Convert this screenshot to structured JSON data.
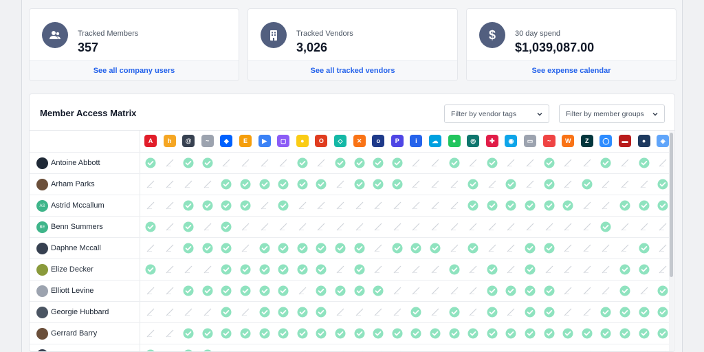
{
  "cards": [
    {
      "label": "Tracked Members",
      "value": "357",
      "link": "See all company users",
      "icon": "users-icon"
    },
    {
      "label": "Tracked Vendors",
      "value": "3,026",
      "link": "See all tracked vendors",
      "icon": "building-icon"
    },
    {
      "label": "30 day spend",
      "value": "$1,039,087.00",
      "link": "See expense calendar",
      "icon": "dollar-icon"
    }
  ],
  "matrix": {
    "title": "Member Access Matrix",
    "filter_vendor_tags": "Filter by vendor tags",
    "filter_member_groups": "Filter by member groups"
  },
  "vendors": [
    {
      "name": "adobe",
      "color": "#e11d2a",
      "glyph": "A"
    },
    {
      "name": "hotjar",
      "color": "#f5a623",
      "glyph": "h"
    },
    {
      "name": "vendor-3",
      "color": "#374151",
      "glyph": "@"
    },
    {
      "name": "vendor-4",
      "color": "#9ca3af",
      "glyph": "~"
    },
    {
      "name": "dropbox",
      "color": "#0061fe",
      "glyph": "◆"
    },
    {
      "name": "vendor-6",
      "color": "#f59e0b",
      "glyph": "E"
    },
    {
      "name": "vendor-7",
      "color": "#3b82f6",
      "glyph": "▶"
    },
    {
      "name": "vendor-8",
      "color": "#8b5cf6",
      "glyph": "▢"
    },
    {
      "name": "mailchimp",
      "color": "#facc15",
      "glyph": "●"
    },
    {
      "name": "office",
      "color": "#e03c1f",
      "glyph": "O"
    },
    {
      "name": "vendor-11",
      "color": "#14b8a6",
      "glyph": "◇"
    },
    {
      "name": "vendor-12",
      "color": "#f97316",
      "glyph": "✕"
    },
    {
      "name": "okta",
      "color": "#1e3a8a",
      "glyph": "o"
    },
    {
      "name": "vendor-14",
      "color": "#4f46e5",
      "glyph": "P"
    },
    {
      "name": "vendor-15",
      "color": "#2563eb",
      "glyph": "i"
    },
    {
      "name": "salesforce",
      "color": "#00a1e0",
      "glyph": "☁"
    },
    {
      "name": "vendor-17",
      "color": "#22c55e",
      "glyph": "●"
    },
    {
      "name": "vendor-18",
      "color": "#0f766e",
      "glyph": "◎"
    },
    {
      "name": "vendor-19",
      "color": "#e11d48",
      "glyph": "✚"
    },
    {
      "name": "vendor-20",
      "color": "#0ea5e9",
      "glyph": "◉"
    },
    {
      "name": "vendor-21",
      "color": "#9ca3af",
      "glyph": "▭"
    },
    {
      "name": "vendor-22",
      "color": "#ef4444",
      "glyph": "~"
    },
    {
      "name": "vendor-23",
      "color": "#f97316",
      "glyph": "W"
    },
    {
      "name": "zendesk",
      "color": "#03363d",
      "glyph": "Z"
    },
    {
      "name": "zoom",
      "color": "#2d8cff",
      "glyph": "◯"
    },
    {
      "name": "vendor-26",
      "color": "#b91c1c",
      "glyph": "▬"
    },
    {
      "name": "vendor-27",
      "color": "#1e3a5f",
      "glyph": "●"
    },
    {
      "name": "vendor-28",
      "color": "#60a5fa",
      "glyph": "◈"
    }
  ],
  "members": [
    {
      "name": "Antoine Abbott",
      "initials": "",
      "avatar_color": "#1f2937",
      "access": "1011000010111100101001001010"
    },
    {
      "name": "Arham Parks",
      "initials": "",
      "avatar_color": "#6b4f3a",
      "access": "0000111111011100010101010001"
    },
    {
      "name": "Astrid Mccallum",
      "initials": "AS",
      "avatar_color": "#3fb58a",
      "access": "0011110100000000011111100111"
    },
    {
      "name": "Benn Summers",
      "initials": "BE",
      "avatar_color": "#3fb58a",
      "access": "1010100000000000000000001000"
    },
    {
      "name": "Daphne Mccall",
      "initials": "",
      "avatar_color": "#374151",
      "access": "0011101111110111010011000010"
    },
    {
      "name": "Elize Decker",
      "initials": "",
      "avatar_color": "#8a9a3b",
      "access": "1000111111010000101010000110"
    },
    {
      "name": "Elliott Levine",
      "initials": "",
      "avatar_color": "#9ca3af",
      "access": "0011111101111000001111000101"
    },
    {
      "name": "Georgie Hubbard",
      "initials": "",
      "avatar_color": "#4b5563",
      "access": "0000101111000010101011001111"
    },
    {
      "name": "Gerrard Barry",
      "initials": "",
      "avatar_color": "#6b4f3a",
      "access": "0011111111111111111111111111"
    },
    {
      "name": "Johnny Bryant",
      "initials": "",
      "avatar_color": "#374151",
      "access": "1011000000000000000000000000"
    }
  ]
}
